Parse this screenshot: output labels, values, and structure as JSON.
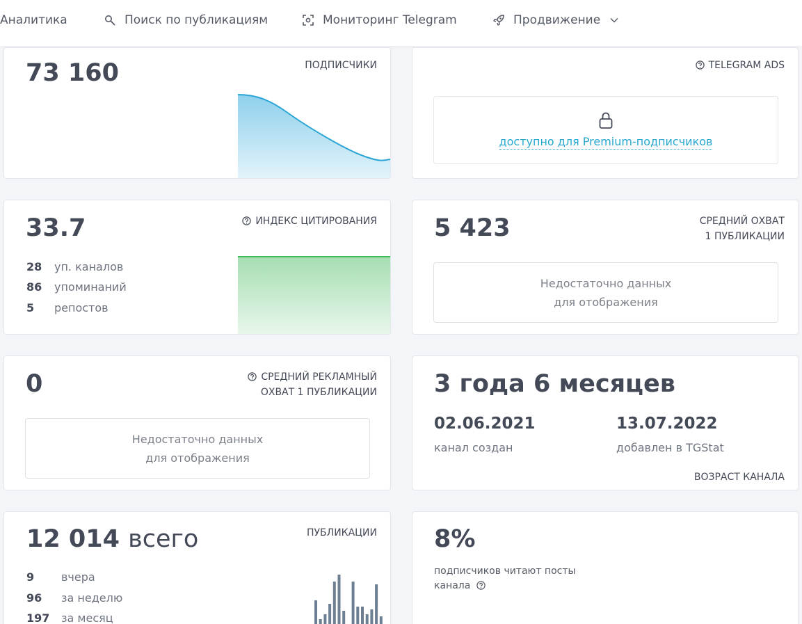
{
  "nav": {
    "items": [
      {
        "label": "Аналитика"
      },
      {
        "label": "Поиск по публикациям"
      },
      {
        "label": "Мониторинг Telegram"
      },
      {
        "label": "Продвижение"
      }
    ]
  },
  "subscribers": {
    "value": "73 160",
    "caption": "ПОДПИСЧИКИ",
    "chart_color": "#2ba5d4"
  },
  "ads": {
    "caption": "TELEGRAM ADS",
    "locked_text": "доступно для Premium-подписчиков"
  },
  "citation": {
    "value": "33.7",
    "caption": "ИНДЕКС ЦИТИРОВАНИЯ",
    "stats": [
      {
        "num": "28",
        "label": "уп. каналов"
      },
      {
        "num": "86",
        "label": "упоминаний"
      },
      {
        "num": "5",
        "label": "репостов"
      }
    ],
    "chart_color": "#3fbb5a"
  },
  "avg_reach": {
    "value": "5 423",
    "caption_line1": "СРЕДНИЙ ОХВАТ",
    "caption_line2": "1 ПУБЛИКАЦИИ",
    "empty_line1": "Недостаточно данных",
    "empty_line2": "для отображения"
  },
  "ad_reach": {
    "value": "0",
    "caption_line1": "СРЕДНИЙ РЕКЛАМНЫЙ",
    "caption_line2": "ОХВАТ 1 ПУБЛИКАЦИИ",
    "empty_line1": "Недостаточно данных",
    "empty_line2": "для отображения"
  },
  "age": {
    "value": "3 года 6 месяцев",
    "created_date": "02.06.2021",
    "created_label": "канал создан",
    "added_date": "13.07.2022",
    "added_label": "добавлен в TGStat",
    "caption": "ВОЗРАСТ КАНАЛА"
  },
  "publications": {
    "value": "12 014",
    "value_suffix": "всего",
    "caption": "ПУБЛИКАЦИИ",
    "stats": [
      {
        "num": "9",
        "label": "вчера"
      },
      {
        "num": "96",
        "label": "за неделю"
      },
      {
        "num": "197",
        "label": "за месяц"
      }
    ],
    "bars": [
      35,
      8,
      15,
      30,
      62,
      72,
      20,
      0,
      62,
      26,
      26,
      15,
      22,
      58,
      12
    ],
    "bar_color": "#6d7f92"
  },
  "readers": {
    "value": "8%",
    "text_line1": "подписчиков читают посты",
    "text_line2": "канала"
  }
}
